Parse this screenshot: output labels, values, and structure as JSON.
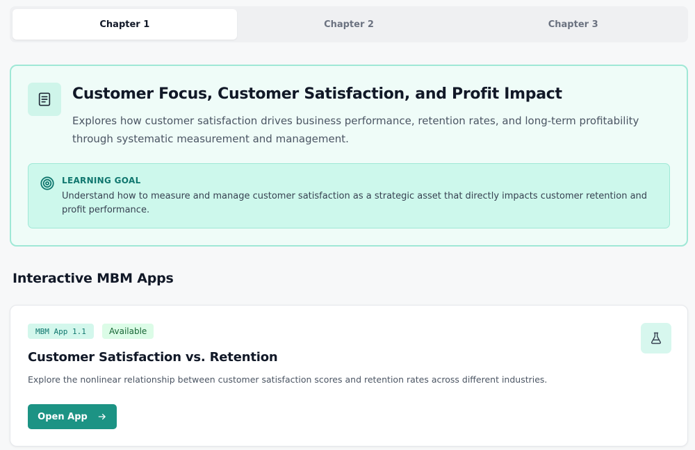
{
  "tabs": [
    {
      "label": "Chapter 1",
      "active": true
    },
    {
      "label": "Chapter 2",
      "active": false
    },
    {
      "label": "Chapter 3",
      "active": false
    }
  ],
  "chapter": {
    "icon": "book-icon",
    "title": "Customer Focus, Customer Satisfaction, and Profit Impact",
    "description": "Explores how customer satisfaction drives business performance, retention rates, and long-term profitability through systematic measurement and management.",
    "learning_goal": {
      "icon": "target-icon",
      "label": "LEARNING GOAL",
      "text": "Understand how to measure and manage customer satisfaction as a strategic asset that directly impacts customer retention and profit performance."
    }
  },
  "apps_section": {
    "heading": "Interactive MBM Apps",
    "apps": [
      {
        "code": "MBM App 1.1",
        "status": "Available",
        "icon": "flask-icon",
        "title": "Customer Satisfaction vs. Retention",
        "description": "Explore the nonlinear relationship between customer satisfaction scores and retention rates across different industries.",
        "button_label": "Open App",
        "button_icon": "arrow-right-icon"
      }
    ]
  },
  "colors": {
    "accent": "#1c9384",
    "accent_dark": "#0f766e",
    "card_bg": "#effcf8",
    "card_border": "#9fe8d6",
    "status_green": "#166534"
  }
}
